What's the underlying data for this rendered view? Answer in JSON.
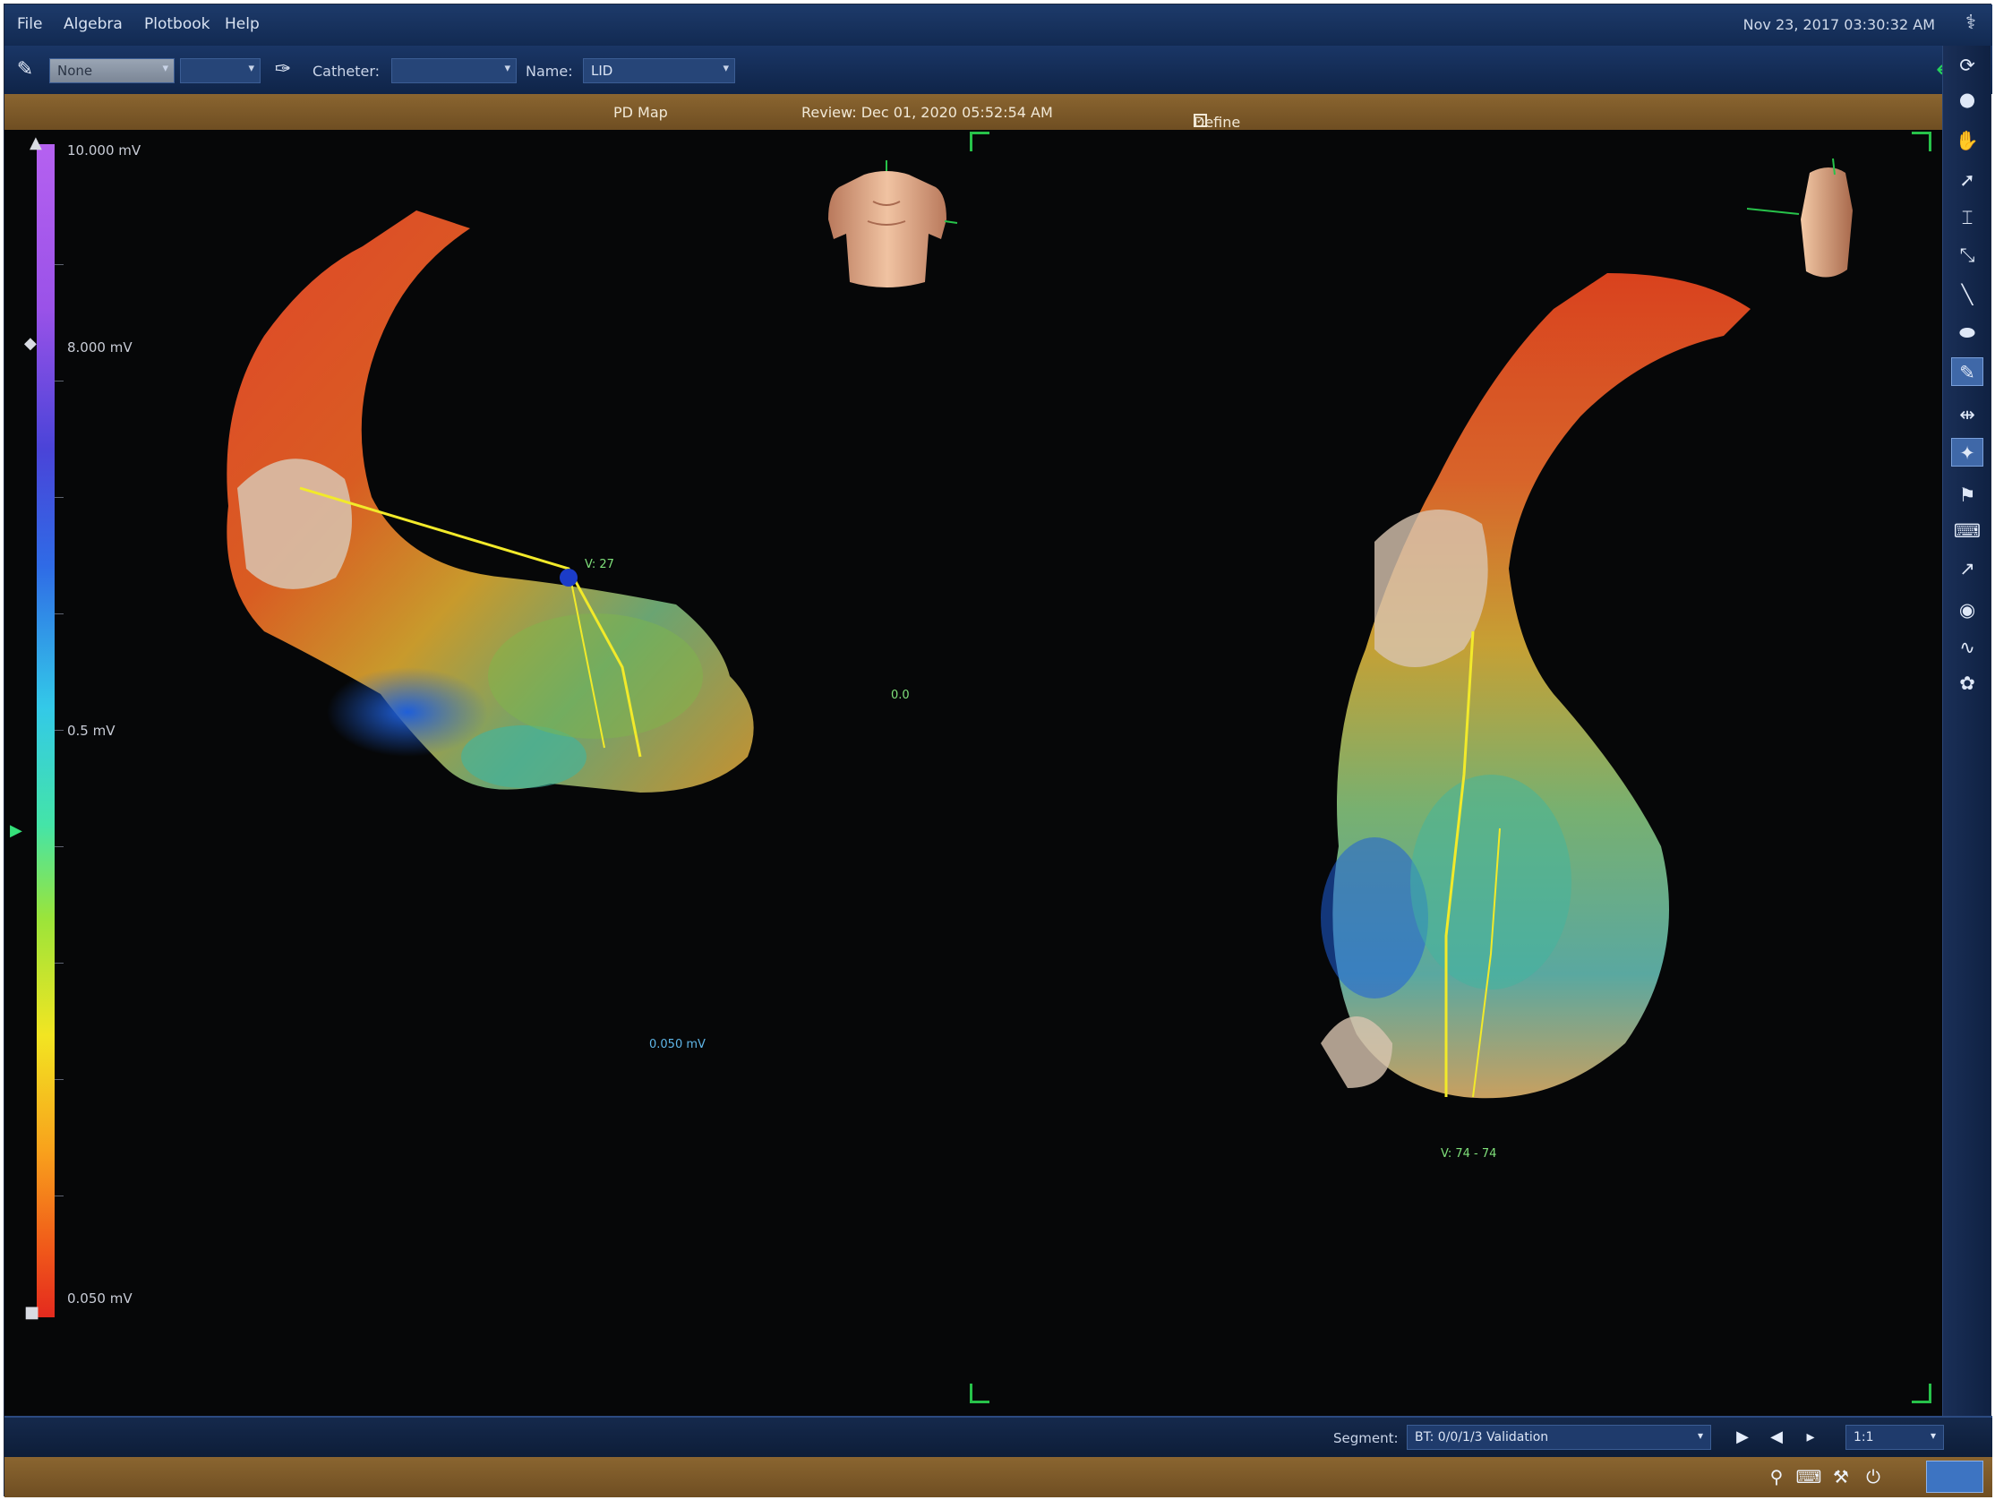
{
  "menu": {
    "items": [
      "File",
      "Algebra",
      "Plotbook",
      "Help"
    ],
    "datetime": "Nov 23, 2017 03:30:32 AM"
  },
  "toolbar": {
    "map_select": "None",
    "catheter_label": "Catheter:",
    "catheter_value": "",
    "name_label": "Name:",
    "name_value": "LID"
  },
  "infobar": {
    "map_name": "PD Map",
    "review_text": "Review: Dec 01, 2020 05:52:54 AM",
    "validation_label": "Define Validation",
    "validation_checked": true
  },
  "colorbar": {
    "max_label": "10.000 mV",
    "upper_label": "8.000 mV",
    "mid_label": "0.5 mV",
    "min_label": "0.050 mV"
  },
  "viewport": {
    "left_map_label_1": "V: 27",
    "left_map_label_2": "0.0",
    "left_map_label_3": "0.050 mV",
    "right_map_label": "V: 74 - 74"
  },
  "segment": {
    "label": "Segment:",
    "value": "BT: 0/0/1/3 Validation",
    "speed": "1:1"
  },
  "icons": {
    "toolstrip": [
      "rotate-icon",
      "dot-icon",
      "hand-icon",
      "pointer-icon",
      "caliper-icon",
      "connect-icon",
      "line-icon",
      "ellipse-icon",
      "pen-icon",
      "split-icon",
      "highlight-icon",
      "flag-icon",
      "camera-icon",
      "curve-icon",
      "eye-icon",
      "wave-icon",
      "color-icon"
    ],
    "colors": {
      "accent_green": "#27c24a",
      "bar_brown": "#7a5828",
      "bar_blue": "#15294c"
    }
  }
}
